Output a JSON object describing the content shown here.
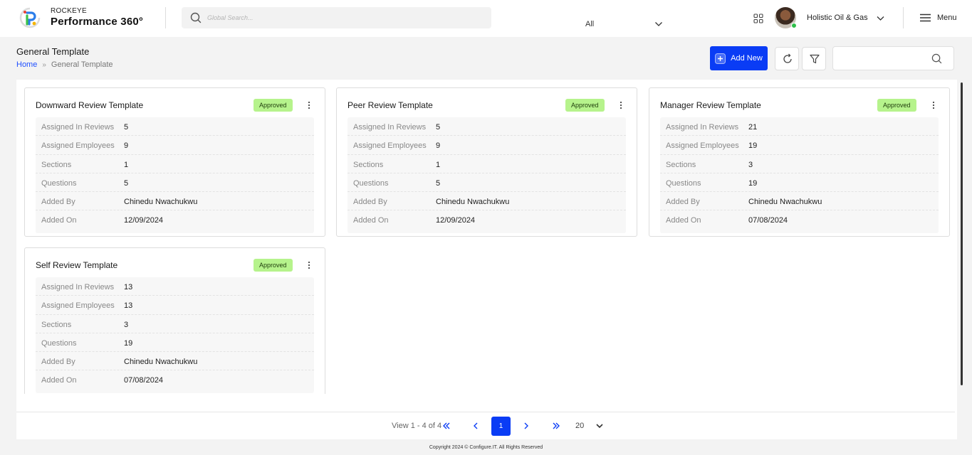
{
  "brand": {
    "line1": "ROCKEYE",
    "line2": "Performance 360°"
  },
  "search": {
    "placeholder": "Global Search...",
    "scope": "All"
  },
  "user": {
    "company": "Holistic Oil & Gas",
    "menu_label": "Menu"
  },
  "page": {
    "title": "General Template",
    "breadcrumb": [
      "Home",
      "General Template"
    ],
    "add_new_label": "Add New"
  },
  "field_labels": {
    "assigned_reviews": "Assigned In Reviews",
    "assigned_employees": "Assigned Employees",
    "sections": "Sections",
    "questions": "Questions",
    "added_by": "Added By",
    "added_on": "Added On"
  },
  "status_color": "#b6f38c",
  "accent_color": "#0a3cf5",
  "templates": [
    {
      "title": "Downward Review Template",
      "status": "Approved",
      "assigned_reviews": "5",
      "assigned_employees": "9",
      "sections": "1",
      "questions": "5",
      "added_by": "Chinedu Nwachukwu",
      "added_on": "12/09/2024"
    },
    {
      "title": "Peer Review Template",
      "status": "Approved",
      "assigned_reviews": "5",
      "assigned_employees": "9",
      "sections": "1",
      "questions": "5",
      "added_by": "Chinedu Nwachukwu",
      "added_on": "12/09/2024"
    },
    {
      "title": "Manager Review Template",
      "status": "Approved",
      "assigned_reviews": "21",
      "assigned_employees": "19",
      "sections": "3",
      "questions": "19",
      "added_by": "Chinedu Nwachukwu",
      "added_on": "07/08/2024"
    },
    {
      "title": "Self Review Template",
      "status": "Approved",
      "assigned_reviews": "13",
      "assigned_employees": "13",
      "sections": "3",
      "questions": "19",
      "added_by": "Chinedu Nwachukwu",
      "added_on": "07/08/2024"
    }
  ],
  "pagination": {
    "view_text": "View 1 - 4 of 4",
    "current_page": "1",
    "per_page": "20"
  },
  "footer": {
    "copyright": "Copyright 2024 © Configure.IT. All Rights Reserved"
  }
}
